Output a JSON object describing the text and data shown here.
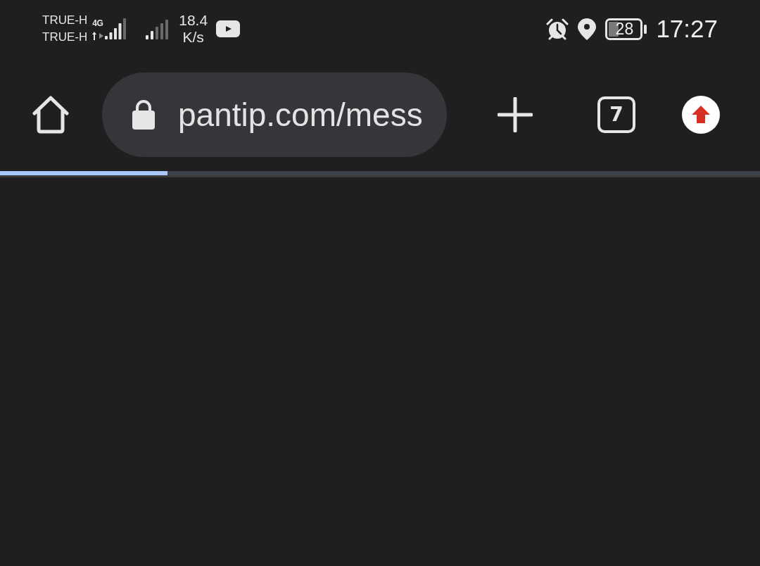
{
  "status_bar": {
    "carriers": [
      "TRUE-H",
      "TRUE-H"
    ],
    "network_type": "4G",
    "speed_value": "18.4",
    "speed_unit": "K/s",
    "battery": "28",
    "time": "17:27"
  },
  "toolbar": {
    "url": "pantip.com/mess",
    "tab_count": "7"
  },
  "page_load_progress": {
    "level": 0.22
  }
}
